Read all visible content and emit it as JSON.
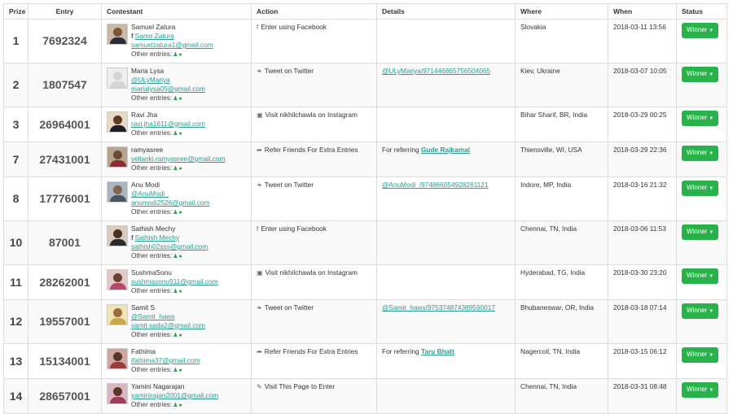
{
  "headers": {
    "prize": "Prize",
    "entry": "Entry",
    "contestant": "Contestant",
    "action": "Action",
    "details": "Details",
    "where": "Where",
    "when": "When",
    "status": "Status"
  },
  "other_entries_label": "Other entries:",
  "status_label": "Winner",
  "rows": [
    {
      "prize": "1",
      "entry": "7692324",
      "name": "Samuel Zatura",
      "handle": "Samo Zatura",
      "handle_icon": "f",
      "email": "samuelzatura1@gmail.com",
      "action_icon": "f",
      "action": "Enter using Facebook",
      "details": "",
      "details_prefix": "",
      "details_link": "",
      "where": "Slovakia",
      "when": "2018-03-11 13:56",
      "height": "tall",
      "avatar": {
        "bg": "#c9b9a3",
        "head": "#7a5538",
        "torso": "#2d2d3a"
      }
    },
    {
      "prize": "2",
      "entry": "1807547",
      "name": "Maria Lysa",
      "handle": "@ULyMariya",
      "handle_icon": "",
      "email": "marialysa05@gmail.com",
      "action_icon": "t",
      "action": "Tweet on Twitter",
      "details": "@ULyMariya/971446865756504065",
      "details_prefix": "",
      "details_link": "",
      "where": "Kiev, Ukraine",
      "when": "2018-03-07 10:05",
      "height": "tall",
      "avatar": {
        "bg": "#eeeeee",
        "head": "#d4d4d4",
        "torso": "#d4d4d4"
      }
    },
    {
      "prize": "3",
      "entry": "26964001",
      "name": "Ravi Jha",
      "handle": "",
      "handle_icon": "",
      "email": "ravi.jha1611@gmail.com",
      "action_icon": "i",
      "action": "Visit nikhilchawla on Instagram",
      "details": "",
      "details_prefix": "",
      "details_link": "",
      "where": "Bihar Sharif, BR, India",
      "when": "2018-03-29 00:25",
      "height": "short",
      "avatar": {
        "bg": "#e8d9c4",
        "head": "#5c3b26",
        "torso": "#1f1f1f"
      }
    },
    {
      "prize": "7",
      "entry": "27431001",
      "name": "ramyasree",
      "handle": "",
      "handle_icon": "",
      "email": "vellanki.ramyasree@gmail.com",
      "action_icon": "r",
      "action": "Refer Friends For Extra Entries",
      "details": "",
      "details_prefix": "For referring",
      "details_link": "Gude Rajkamal",
      "where": "Thiensville, WI, USA",
      "when": "2018-03-29 22:36",
      "height": "short",
      "avatar": {
        "bg": "#b7a48d",
        "head": "#6b4a33",
        "torso": "#8a2f2f"
      }
    },
    {
      "prize": "8",
      "entry": "17776001",
      "name": "Anu Modi",
      "handle": "@AnuModi_",
      "handle_icon": "",
      "email": "anumodi2526@gmail.com",
      "action_icon": "t",
      "action": "Tweet on Twitter",
      "details": "@AnuModi_/974866054928261121",
      "details_prefix": "",
      "details_link": "",
      "where": "Indore, MP, India",
      "when": "2018-03-16 21:32",
      "height": "tall",
      "avatar": {
        "bg": "#a9b4bf",
        "head": "#7f6552",
        "torso": "#4a5561"
      }
    },
    {
      "prize": "10",
      "entry": "87001",
      "name": "Sathish Mechy",
      "handle": "Sathish Mechy",
      "handle_icon": "f",
      "email": "sathish02sss@gmail.com",
      "action_icon": "f",
      "action": "Enter using Facebook",
      "details": "",
      "details_prefix": "",
      "details_link": "",
      "where": "Chennai, TN, India",
      "when": "2018-03-06 11:53",
      "height": "tall",
      "avatar": {
        "bg": "#d7cbbd",
        "head": "#4b3122",
        "torso": "#2a2a2a"
      }
    },
    {
      "prize": "11",
      "entry": "28262001",
      "name": "SushmaSonu",
      "handle": "",
      "handle_icon": "",
      "email": "sushmasonu911@gmail.com",
      "action_icon": "i",
      "action": "Visit nikhilchawla on Instagram",
      "details": "",
      "details_prefix": "",
      "details_link": "",
      "where": "Hyderabad, TG, India",
      "when": "2018-03-30 23:20",
      "height": "short",
      "avatar": {
        "bg": "#e4c8c8",
        "head": "#6a4331",
        "torso": "#b8466a"
      }
    },
    {
      "prize": "12",
      "entry": "19557001",
      "name": "Samit S",
      "handle": "@Samit_hawx",
      "handle_icon": "",
      "email": "samit.sada2@gmail.com",
      "action_icon": "t",
      "action": "Tweet on Twitter",
      "details": "@Samit_hawx/975374874389590017",
      "details_prefix": "",
      "details_link": "",
      "where": "Bhubaneswar, OR, India",
      "when": "2018-03-18 07:14",
      "height": "tall",
      "avatar": {
        "bg": "#f2e3b5",
        "head": "#9a6a3a",
        "torso": "#c9a64a"
      }
    },
    {
      "prize": "13",
      "entry": "15134001",
      "name": "Fathima",
      "handle": "",
      "handle_icon": "",
      "email": "ifathima37@gmail.com",
      "action_icon": "r",
      "action": "Refer Friends For Extra Entries",
      "details": "",
      "details_prefix": "For referring",
      "details_link": "Taru Bhatt",
      "where": "Nagercoil, TN, India",
      "when": "2018-03-15 06:12",
      "height": "short",
      "avatar": {
        "bg": "#cfa7a0",
        "head": "#5a3526",
        "torso": "#9c3d3d"
      }
    },
    {
      "prize": "14",
      "entry": "28657001",
      "name": "Yamini Nagarajan",
      "handle": "",
      "handle_icon": "",
      "email": "yaminirajan2001@gmail.com",
      "action_icon": "p",
      "action": "Visit This Page to Enter",
      "details": "",
      "details_prefix": "",
      "details_link": "",
      "where": "Chennai, TN, India",
      "when": "2018-03-31 08:48",
      "height": "short",
      "avatar": {
        "bg": "#d8b7c2",
        "head": "#5b3728",
        "torso": "#a33a5c"
      }
    }
  ]
}
